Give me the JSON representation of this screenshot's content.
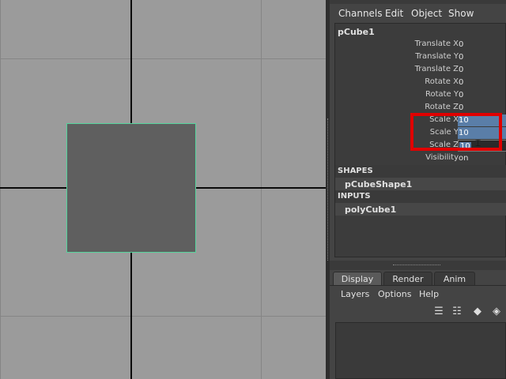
{
  "channel_box": {
    "menu": [
      "Channels",
      "Edit",
      "Object",
      "Show"
    ],
    "node_name": "pCube1",
    "attributes": [
      {
        "label": "Translate X",
        "value": "0"
      },
      {
        "label": "Translate Y",
        "value": "0"
      },
      {
        "label": "Translate Z",
        "value": "0"
      },
      {
        "label": "Rotate X",
        "value": "0"
      },
      {
        "label": "Rotate Y",
        "value": "0"
      },
      {
        "label": "Rotate Z",
        "value": "0"
      },
      {
        "label": "Scale X",
        "value": "10"
      },
      {
        "label": "Scale Y",
        "value": "10"
      },
      {
        "label": "Scale Z",
        "value": "10"
      },
      {
        "label": "Visibility",
        "value": "on"
      }
    ],
    "shapes_header": "SHAPES",
    "shape_node": "pCubeShape1",
    "inputs_header": "INPUTS",
    "input_node": "polyCube1"
  },
  "layer_editor": {
    "tabs": [
      "Display",
      "Render",
      "Anim"
    ],
    "active_tab": "Display",
    "menu": [
      "Layers",
      "Options",
      "Help"
    ],
    "tool_icons": [
      "new-layer-icon",
      "new-layer-selected-icon",
      "new-empty-layer-icon",
      "new-layer-from-selected-icon"
    ]
  },
  "colors": {
    "selection_highlight": "#5a7ea8",
    "annotation_box": "#e00000",
    "object_outline": "#55d39c"
  }
}
